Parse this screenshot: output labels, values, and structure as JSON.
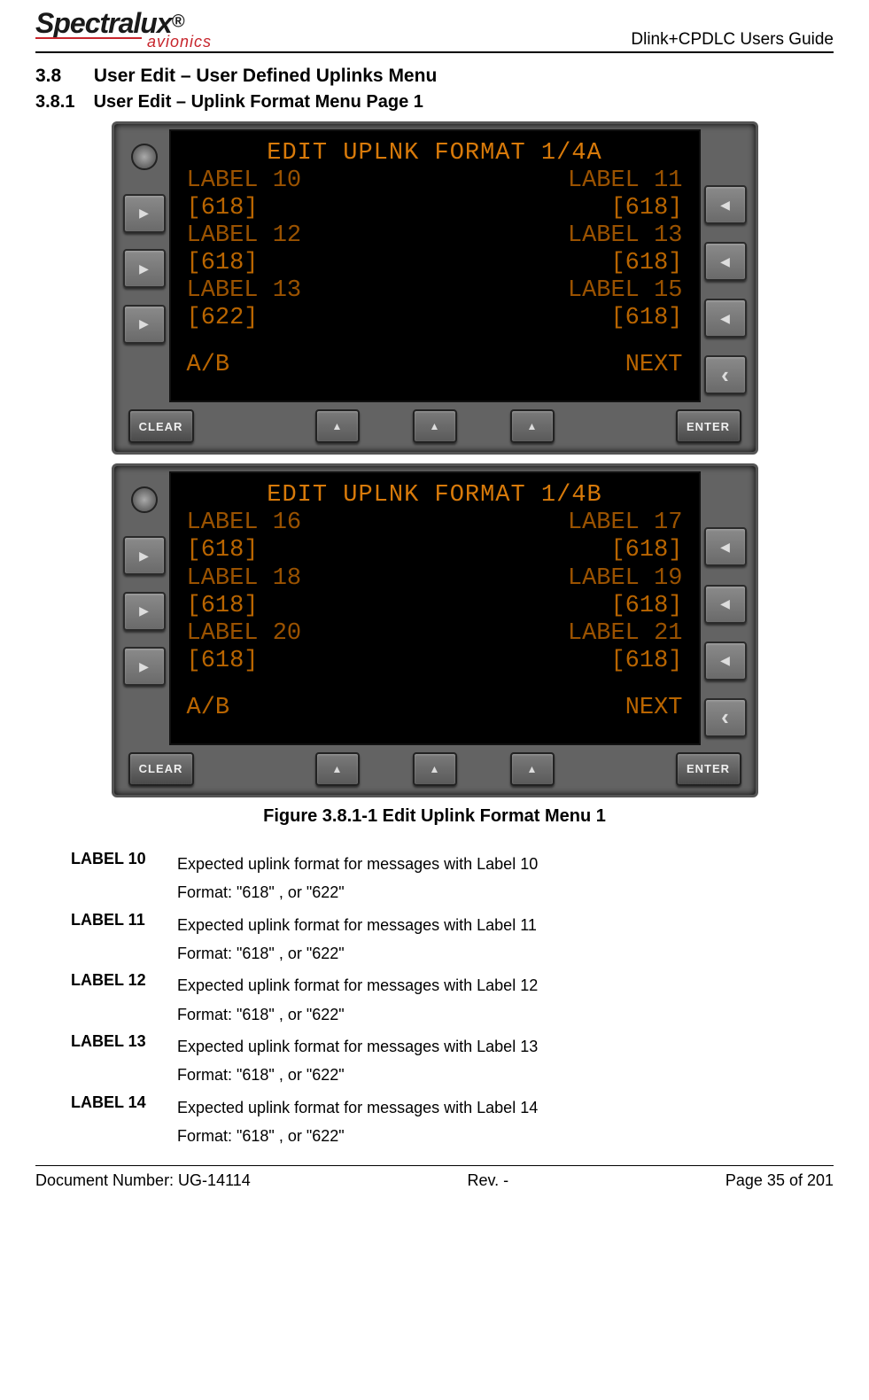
{
  "header": {
    "logo_main_a": "Spectra",
    "logo_main_b": "lux",
    "logo_sub": "avionics",
    "guide": "Dlink+CPDLC Users Guide"
  },
  "section": {
    "num1": "3.8",
    "title1": "User Edit – User Defined Uplinks Menu",
    "num2": "3.8.1",
    "title2": "User Edit – Uplink Format Menu Page 1"
  },
  "cdu_a": {
    "title": "EDIT UPLNK FORMAT 1/4A",
    "l1l": "LABEL 10",
    "l1r": "LABEL 11",
    "v1l": "[618]",
    "v1r": "[618]",
    "l2l": "LABEL 12",
    "l2r": "LABEL 13",
    "v2l": "[618]",
    "v2r": "[618]",
    "l3l": "LABEL 13",
    "l3r": "LABEL 15",
    "v3l": "[622]",
    "v3r": "[618]",
    "bl": "A/B",
    "br": "NEXT"
  },
  "cdu_b": {
    "title": "EDIT UPLNK FORMAT 1/4B",
    "l1l": "LABEL 16",
    "l1r": "LABEL 17",
    "v1l": "[618]",
    "v1r": "[618]",
    "l2l": "LABEL 18",
    "l2r": "LABEL 19",
    "v2l": "[618]",
    "v2r": "[618]",
    "l3l": "LABEL 20",
    "l3r": "LABEL 21",
    "v3l": "[618]",
    "v3r": "[618]",
    "bl": "A/B",
    "br": "NEXT"
  },
  "buttons": {
    "clear": "CLEAR",
    "enter": "ENTER"
  },
  "caption": "Figure 3.8.1-1 Edit Uplink Format Menu 1",
  "desc": [
    {
      "label": "LABEL 10",
      "line1": "Expected uplink format for messages with Label 10",
      "line2": "Format: \"618\" , or \"622\""
    },
    {
      "label": "LABEL 11",
      "line1": "Expected uplink format for messages with Label 11",
      "line2": "Format: \"618\" , or \"622\""
    },
    {
      "label": "LABEL 12",
      "line1": "Expected uplink format for messages with Label 12",
      "line2": "Format: \"618\" , or \"622\""
    },
    {
      "label": "LABEL 13",
      "line1": "Expected uplink format for messages with Label 13",
      "line2": "Format: \"618\" , or \"622\""
    },
    {
      "label": "LABEL 14",
      "line1": "Expected uplink format for messages with Label 14",
      "line2": "Format: \"618\" , or \"622\""
    }
  ],
  "footer": {
    "doc": "Document Number:  UG-14114",
    "rev": "Rev. -",
    "page": "Page 35 of 201"
  }
}
